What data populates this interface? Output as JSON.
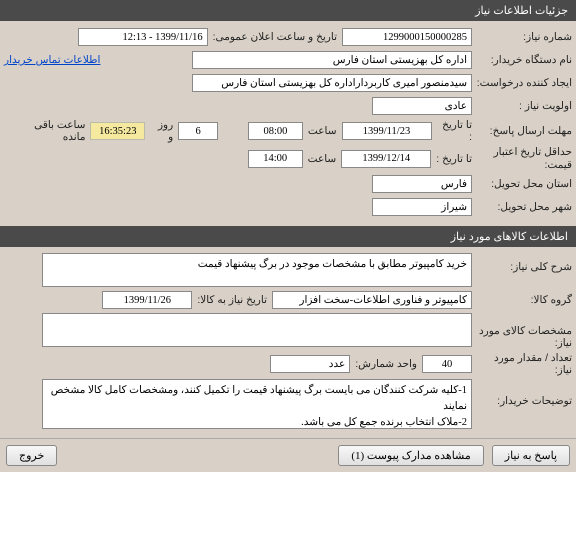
{
  "section1": {
    "title": "جزئیات اطلاعات نیاز",
    "need_number_label": "شماره نیاز:",
    "need_number": "1299000150000285",
    "public_datetime_label": "تاریخ و ساعت اعلان عمومی:",
    "public_datetime": "1399/11/16 - 12:13",
    "buyer_org_label": "نام دستگاه خریدار:",
    "buyer_org": "اداره کل بهزیستی استان فارس",
    "buyer_contact_link": "اطلاعات تماس خریدار",
    "requester_label": "ایجاد کننده درخواست:",
    "requester": "سیدمنصور امیری کاربرداراداره کل بهزیستی استان فارس",
    "priority_label": "اولویت نیاز :",
    "priority": "عادی",
    "deadline_label": "مهلت ارسال پاسخ:",
    "until_label": "تا تاریخ :",
    "deadline_date": "1399/11/23",
    "time_label": "ساعت",
    "deadline_time": "08:00",
    "days_remaining": "6",
    "days_label": "روز و",
    "time_remaining": "16:35:23",
    "time_remaining_label": "ساعت باقی مانده",
    "min_validity_label": "حداقل تاریخ اعتبار قیمت:",
    "min_validity_date": "1399/12/14",
    "min_validity_time": "14:00",
    "delivery_province_label": "استان محل تحویل:",
    "delivery_province": "فارس",
    "delivery_city_label": "شهر محل تحویل:",
    "delivery_city": "شیراز"
  },
  "section2": {
    "title": "اطلاعات کالاهای مورد نیاز",
    "need_desc_label": "شرح کلی نیاز:",
    "need_desc": "خرید کامپیوتر مطابق با مشخصات موجود در برگ پیشنهاد قیمت",
    "goods_group_label": "گروه کالا:",
    "goods_group": "کامپیوتر و فناوری اطلاعات-سخت افزار",
    "need_by_date_label": "تاریخ نیاز به کالا:",
    "need_by_date": "1399/11/26",
    "goods_spec_label": "مشخصات کالای مورد نیاز:",
    "goods_spec": "",
    "qty_label": "تعداد / مقدار مورد نیاز:",
    "qty": "40",
    "unit_label": "واحد شمارش:",
    "unit": "عدد",
    "buyer_notes_label": "توضیحات خریدار:",
    "buyer_notes": "1-کلیه شرکت کنندگان می بایست برگ پیشنهاد قیمت را تکمیل کنند، ومشخصات کامل کالا مشخص نمایند\n2-ملاک انتخاب برنده جمع کل می باشد.\nخرید منوط به اخذ تاییدیه صلاحیت فروشنده، از مراجع ذیصلاح می باشد"
  },
  "buttons": {
    "respond": "پاسخ به نیاز",
    "view_docs": "مشاهده مدارک پیوست (1)",
    "exit": "خروج"
  }
}
